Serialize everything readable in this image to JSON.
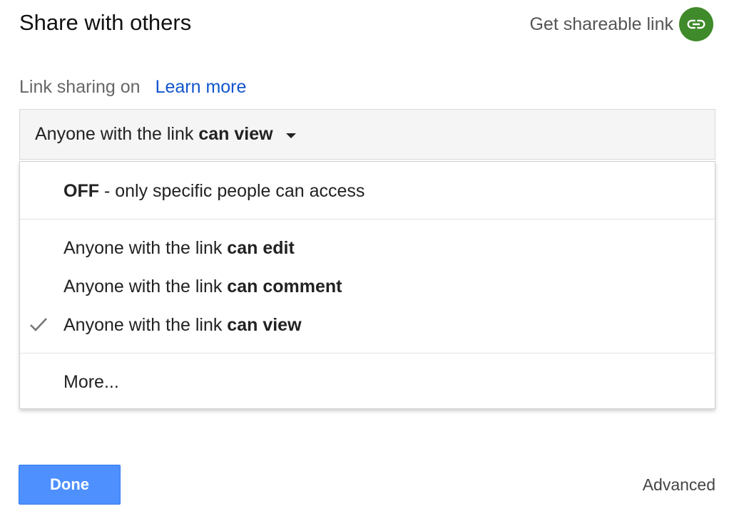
{
  "dialog": {
    "title": "Share with others",
    "get_link_label": "Get shareable link",
    "get_link_icon": "link-icon",
    "link_icon_color": "#3f8a2a"
  },
  "link_status": {
    "text": "Link sharing on",
    "learn_more": "Learn more"
  },
  "access_select": {
    "prefix": "Anyone with the link",
    "bold": "can view"
  },
  "menu": {
    "off_option": {
      "bold": "OFF",
      "rest": " - only specific people can access"
    },
    "options": [
      {
        "prefix": "Anyone with the link ",
        "bold": "can edit",
        "selected": false
      },
      {
        "prefix": "Anyone with the link ",
        "bold": "can comment",
        "selected": false
      },
      {
        "prefix": "Anyone with the link ",
        "bold": "can view",
        "selected": true
      }
    ],
    "more_label": "More..."
  },
  "footer": {
    "done_label": "Done",
    "advanced_label": "Advanced",
    "done_color": "#4d90fe"
  }
}
